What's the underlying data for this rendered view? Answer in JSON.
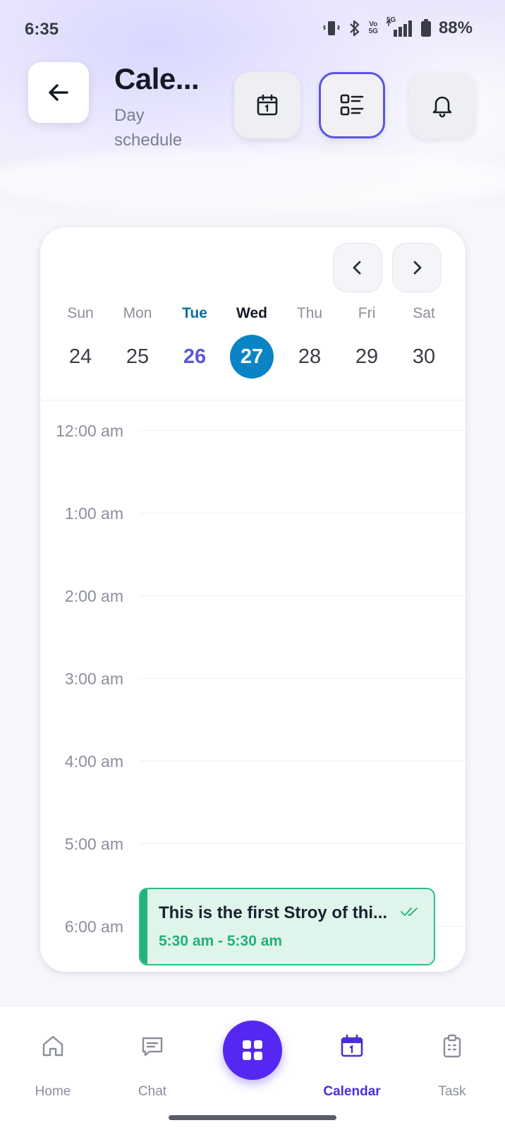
{
  "status_bar": {
    "time": "6:35",
    "battery": "88%",
    "net_top": "Vo",
    "net_bottom": "5G",
    "signal_label": "5G",
    "icons": [
      "vibrate-icon",
      "bluetooth-icon",
      "volte-icon",
      "signal-icon",
      "battery-icon"
    ]
  },
  "header": {
    "title": "Cale...",
    "subtitle": "Day schedule",
    "buttons": [
      "calendar-icon",
      "list-view-icon",
      "bell-icon"
    ]
  },
  "calendar": {
    "week": [
      {
        "name": "Sun",
        "num": "24"
      },
      {
        "name": "Mon",
        "num": "25"
      },
      {
        "name": "Tue",
        "num": "26"
      },
      {
        "name": "Wed",
        "num": "27"
      },
      {
        "name": "Thu",
        "num": "28"
      },
      {
        "name": "Fri",
        "num": "29"
      },
      {
        "name": "Sat",
        "num": "30"
      }
    ],
    "today_index": 2,
    "selected_index": 3,
    "hours": [
      "12:00 am",
      "1:00 am",
      "2:00 am",
      "3:00 am",
      "4:00 am",
      "5:00 am",
      "6:00 am"
    ],
    "event": {
      "title": "This is the first Stroy of thi...",
      "time": "5:30 am - 5:30 am"
    }
  },
  "bottom_nav": {
    "items": [
      {
        "label": "Home",
        "icon": "home-icon"
      },
      {
        "label": "Chat",
        "icon": "chat-icon"
      },
      {
        "label": "Calendar",
        "icon": "calendar-icon"
      },
      {
        "label": "Task",
        "icon": "clipboard-icon"
      }
    ],
    "active": "Calendar",
    "fab_icon": "grid-icon"
  },
  "colors": {
    "accent": "#5627f0",
    "selected_day": "#0b84c6",
    "today": "#5d58d6",
    "event_bg": "#dff4ea",
    "event_border": "#28c08a"
  }
}
